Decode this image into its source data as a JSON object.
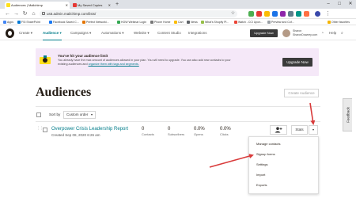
{
  "browser": {
    "tabs": [
      {
        "title": "Audiences | Mailchimp",
        "active": true
      },
      {
        "title": "My Saved Copies",
        "active": false
      }
    ],
    "url": "us6.admin.mailchimp.com/lists/",
    "bookmarks": [
      {
        "label": "Apps",
        "color": "#4285f4"
      },
      {
        "label": "FSI SharePoint",
        "color": "#0078d4"
      },
      {
        "label": "Facebook Saved C...",
        "color": "#1877f2"
      },
      {
        "label": "Perfect Networki...",
        "color": "#e37400"
      },
      {
        "label": "HOW Webinar Login",
        "color": "#34a853"
      },
      {
        "label": "Phone Home",
        "color": "#777777"
      },
      {
        "label": "Cart",
        "color": "#fbbc04"
      },
      {
        "label": "News",
        "color": "#5f6368"
      },
      {
        "label": "What's Shopify Pl...",
        "color": "#96bf48"
      },
      {
        "label": "Watch - CCI Upon...",
        "color": "#ea4335"
      },
      {
        "label": "Preview and Cof...",
        "color": "#9aa0a6"
      }
    ],
    "other_bookmarks": "Other favorites"
  },
  "nav": {
    "items": [
      {
        "label": "Create ▾",
        "active": false
      },
      {
        "label": "Audience ▾",
        "active": true
      },
      {
        "label": "Campaigns ▾",
        "active": false
      },
      {
        "label": "Automations ▾",
        "active": false
      },
      {
        "label": "Website ▾",
        "active": false
      },
      {
        "label": "Content Studio",
        "active": false
      },
      {
        "label": "Integrations",
        "active": false
      }
    ],
    "upgrade_label": "Upgrade Now",
    "account_name": "Sharon",
    "account_sub": "SharonDowney.com",
    "help_label": "Help"
  },
  "banner": {
    "title": "You've hit your audience limit",
    "body": "You already have the max amount of audiences allowed in your plan. You will need to upgrade. You can also add new contacts to your existing audiences and",
    "link_text": "organize them with tags and segments.",
    "button_label": "Upgrade Now"
  },
  "page": {
    "title": "Audiences",
    "create_label": "Create Audience",
    "sort_label": "Sort by",
    "sort_value": "Custom order"
  },
  "audience": {
    "name": "Overpower Crisis Leadership Report",
    "created": "Created Sep 08, 2020 6:26 am",
    "stats": [
      {
        "value": "0",
        "label": "Contacts"
      },
      {
        "value": "0",
        "label": "Subscribers"
      },
      {
        "value": "0.0%",
        "label": "Opens"
      },
      {
        "value": "0.0%",
        "label": "Clicks"
      }
    ],
    "stats_button": "Stats",
    "people_icon": "add-person-icon"
  },
  "menu": {
    "items": [
      "Manage contacts",
      "Signup forms",
      "Settings",
      "Import",
      "Exports"
    ]
  },
  "feedback_label": "Feedback",
  "colors": {
    "accent": "#007c89",
    "banner_bg": "#f5e8f8",
    "dark_button": "#3a3a3a",
    "arrow_red": "#d93b3b"
  }
}
